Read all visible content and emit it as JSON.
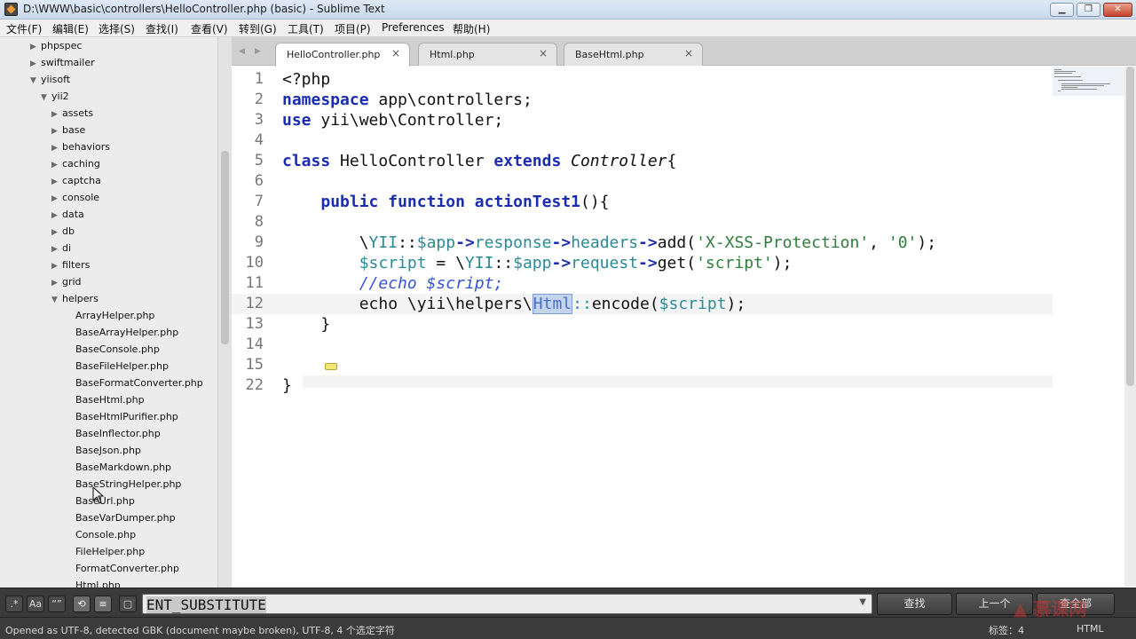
{
  "window": {
    "title": "D:\\WWW\\basic\\controllers\\HelloController.php (basic) - Sublime Text"
  },
  "menu": [
    "文件(F)",
    "编辑(E)",
    "选择(S)",
    "查找(I)",
    "查看(V)",
    "转到(G)",
    "工具(T)",
    "项目(P)",
    "Preferences",
    "帮助(H)"
  ],
  "sidebar": {
    "items": [
      {
        "label": "phpspec",
        "arrow": "▶"
      },
      {
        "label": "swiftmailer",
        "arrow": "▶"
      },
      {
        "label": "yiisoft",
        "arrow": "▼"
      },
      {
        "label": "yii2",
        "arrow": "▼"
      },
      {
        "label": "assets",
        "arrow": "▶"
      },
      {
        "label": "base",
        "arrow": "▶"
      },
      {
        "label": "behaviors",
        "arrow": "▶"
      },
      {
        "label": "caching",
        "arrow": "▶"
      },
      {
        "label": "captcha",
        "arrow": "▶"
      },
      {
        "label": "console",
        "arrow": "▶"
      },
      {
        "label": "data",
        "arrow": "▶"
      },
      {
        "label": "db",
        "arrow": "▶"
      },
      {
        "label": "di",
        "arrow": "▶"
      },
      {
        "label": "filters",
        "arrow": "▶"
      },
      {
        "label": "grid",
        "arrow": "▶"
      },
      {
        "label": "helpers",
        "arrow": "▼"
      },
      {
        "label": "ArrayHelper.php",
        "arrow": ""
      },
      {
        "label": "BaseArrayHelper.php",
        "arrow": ""
      },
      {
        "label": "BaseConsole.php",
        "arrow": ""
      },
      {
        "label": "BaseFileHelper.php",
        "arrow": ""
      },
      {
        "label": "BaseFormatConverter.php",
        "arrow": ""
      },
      {
        "label": "BaseHtml.php",
        "arrow": ""
      },
      {
        "label": "BaseHtmlPurifier.php",
        "arrow": ""
      },
      {
        "label": "BaseInflector.php",
        "arrow": ""
      },
      {
        "label": "BaseJson.php",
        "arrow": ""
      },
      {
        "label": "BaseMarkdown.php",
        "arrow": ""
      },
      {
        "label": "BaseStringHelper.php",
        "arrow": ""
      },
      {
        "label": "BaseUrl.php",
        "arrow": ""
      },
      {
        "label": "BaseVarDumper.php",
        "arrow": ""
      },
      {
        "label": "Console.php",
        "arrow": ""
      },
      {
        "label": "FileHelper.php",
        "arrow": ""
      },
      {
        "label": "FormatConverter.php",
        "arrow": ""
      },
      {
        "label": "Html.php",
        "arrow": ""
      }
    ]
  },
  "tabs": [
    {
      "label": "HelloController.php",
      "close": "×",
      "active": true
    },
    {
      "label": "Html.php",
      "close": "×",
      "active": false
    },
    {
      "label": "BaseHtml.php",
      "close": "×",
      "active": false
    }
  ],
  "tab_nav": {
    "left": "◀",
    "right": "▶"
  },
  "editor": {
    "active_line": "12",
    "lines": [
      {
        "num": "1",
        "segments": [
          [
            "<?php",
            ""
          ]
        ]
      },
      {
        "num": "2",
        "segments": [
          [
            "namespace",
            "kw"
          ],
          [
            " app\\controllers;",
            ""
          ]
        ]
      },
      {
        "num": "3",
        "segments": [
          [
            "use",
            "kw"
          ],
          [
            " yii\\web\\Controller;",
            ""
          ]
        ]
      },
      {
        "num": "4",
        "segments": []
      },
      {
        "num": "5",
        "segments": [
          [
            "class",
            "kw"
          ],
          [
            " HelloController ",
            ""
          ],
          [
            "extends",
            "kw"
          ],
          [
            " ",
            ""
          ],
          [
            "Controller",
            "it"
          ],
          [
            "{",
            ""
          ]
        ]
      },
      {
        "num": "6",
        "segments": []
      },
      {
        "num": "7",
        "segments": [
          [
            "    ",
            ""
          ],
          [
            "public",
            "kw"
          ],
          [
            " ",
            ""
          ],
          [
            "function",
            "kw"
          ],
          [
            " ",
            ""
          ],
          [
            "actionTest1",
            "kw"
          ],
          [
            "(){",
            ""
          ]
        ]
      },
      {
        "num": "8",
        "segments": []
      },
      {
        "num": "9",
        "segments": [
          [
            "        \\",
            ""
          ],
          [
            "YII",
            "var"
          ],
          [
            "::",
            ""
          ],
          [
            "$app",
            "var"
          ],
          [
            "->",
            "kw"
          ],
          [
            "response",
            "var"
          ],
          [
            "->",
            "kw"
          ],
          [
            "headers",
            "var"
          ],
          [
            "->",
            "kw"
          ],
          [
            "add(",
            ""
          ],
          [
            "'X-XSS-Protection'",
            "str"
          ],
          [
            ", ",
            ""
          ],
          [
            "'0'",
            "str"
          ],
          [
            ");",
            ""
          ]
        ]
      },
      {
        "num": "10",
        "segments": [
          [
            "        ",
            ""
          ],
          [
            "$script",
            "var"
          ],
          [
            " = \\",
            ""
          ],
          [
            "YII",
            "var"
          ],
          [
            "::",
            ""
          ],
          [
            "$app",
            "var"
          ],
          [
            "->",
            "kw"
          ],
          [
            "request",
            "var"
          ],
          [
            "->",
            "kw"
          ],
          [
            "get(",
            ""
          ],
          [
            "'script'",
            "str"
          ],
          [
            ");",
            ""
          ]
        ]
      },
      {
        "num": "11",
        "segments": [
          [
            "        ",
            ""
          ],
          [
            "//echo $script;",
            "cmt"
          ]
        ]
      },
      {
        "num": "12",
        "segments": [
          [
            "        echo \\yii\\helpers\\",
            ""
          ],
          [
            "Html",
            "sel"
          ],
          [
            "::",
            "var"
          ],
          [
            "encode(",
            ""
          ],
          [
            "$script",
            "var"
          ],
          [
            ");",
            ""
          ]
        ]
      },
      {
        "num": "13",
        "segments": [
          [
            "    }",
            ""
          ]
        ]
      },
      {
        "num": "14",
        "segments": []
      },
      {
        "num": "15",
        "segments": []
      },
      {
        "num": "22",
        "segments": [
          [
            "}",
            ""
          ]
        ]
      }
    ]
  },
  "find_panel": {
    "toggles": [
      {
        "name": "regex-toggle",
        "label": ".*",
        "on": false
      },
      {
        "name": "case-toggle",
        "label": "Aa",
        "on": false
      },
      {
        "name": "whole-word-toggle",
        "label": "“”",
        "on": false
      },
      {
        "name": "wrap-toggle",
        "label": "⟲",
        "on": true
      },
      {
        "name": "in-selection-toggle",
        "label": "≡",
        "on": true
      },
      {
        "name": "highlight-toggle",
        "label": "▢",
        "on": false
      }
    ],
    "query": "ENT_SUBSTITUTE",
    "dropdown": "▼",
    "find_label": "查找",
    "prev_label": "上一个",
    "all_label": "查全部"
  },
  "status": {
    "left": "Opened as UTF-8, detected GBK (document maybe broken), UTF-8, 4 个选定字符",
    "tab_size": "标签：4",
    "syntax": "HTML"
  },
  "watermark": "慕课网",
  "colors": {
    "keyword": "#1a2db0",
    "variable": "#2a8a96",
    "string": "#2f7d3d",
    "comment": "#3454d8",
    "selection": "#c3d4ec"
  }
}
